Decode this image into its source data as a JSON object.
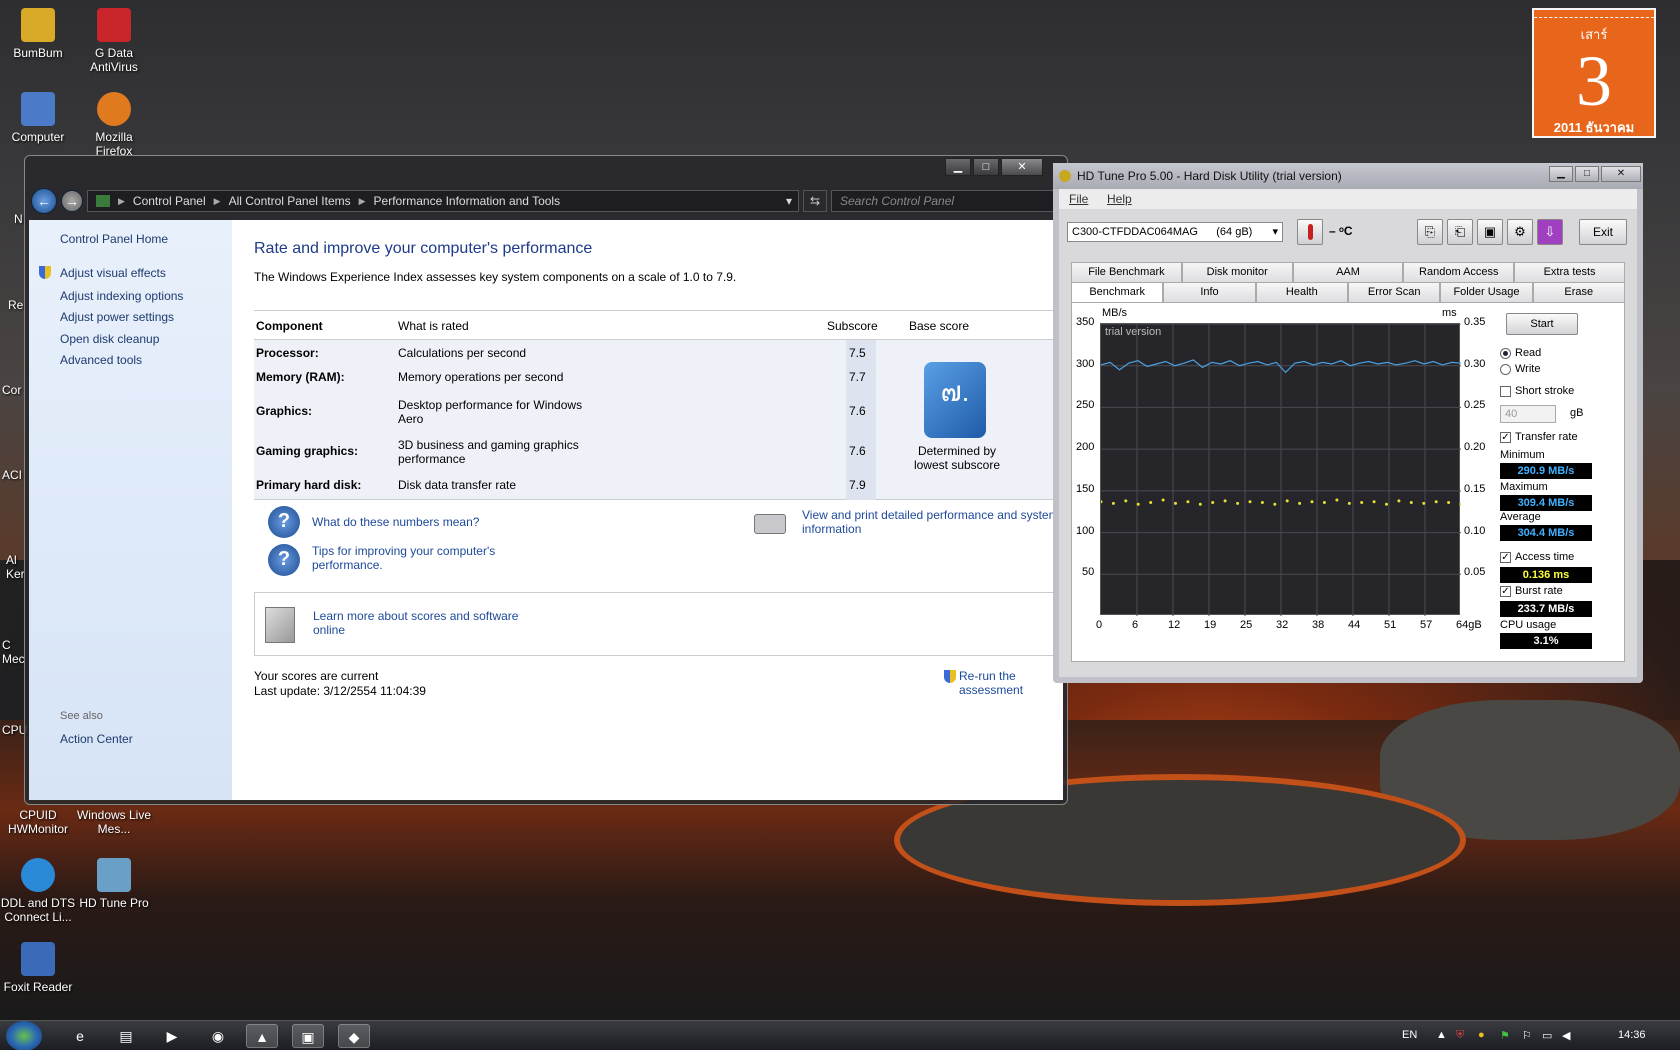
{
  "desktop": {
    "icons": [
      {
        "label": "BumBum",
        "color": "#d9a928"
      },
      {
        "label": "G Data AntiVirus",
        "color": "#c8262a"
      },
      {
        "label": "Computer",
        "color": "#4a7ac8"
      },
      {
        "label": "Mozilla Firefox",
        "color": "#e07a1e"
      },
      {
        "label": "CPUID HWMonitor",
        "color": "#888888"
      },
      {
        "label": "Windows Live Mes...",
        "color": "#4a9ad8"
      },
      {
        "label": "DDL and DTS Connect Li...",
        "color": "#2a8ad8"
      },
      {
        "label": "HD Tune Pro",
        "color": "#6aa0c8"
      },
      {
        "label": "Foxit Reader",
        "color": "#3a6ab8"
      }
    ],
    "edge_labels": [
      "N",
      "Re",
      "Cor",
      "ACI",
      "Al Ker",
      "C Mec",
      "CPU"
    ]
  },
  "calendar": {
    "dow": "เสาร์",
    "day": "3",
    "month_year": "2011 ธันวาคม"
  },
  "control_panel": {
    "breadcrumb": [
      "Control Panel",
      "All Control Panel Items",
      "Performance Information and Tools"
    ],
    "search_placeholder": "Search Control Panel",
    "sidebar": {
      "home": "Control Panel Home",
      "links": [
        "Adjust visual effects",
        "Adjust indexing options",
        "Adjust power settings",
        "Open disk cleanup",
        "Advanced tools"
      ],
      "see_also": "See also",
      "action_center": "Action Center"
    },
    "title": "Rate and improve your computer's performance",
    "description": "The Windows Experience Index assesses key system components on a scale of 1.0 to 7.9.",
    "headers": {
      "component": "Component",
      "rated": "What is rated",
      "subscore": "Subscore",
      "base": "Base score"
    },
    "rows": [
      {
        "component": "Processor:",
        "rated": "Calculations per second",
        "subscore": "7.5"
      },
      {
        "component": "Memory (RAM):",
        "rated": "Memory operations per second",
        "subscore": "7.7"
      },
      {
        "component": "Graphics:",
        "rated": "Desktop performance for Windows Aero",
        "subscore": "7.6"
      },
      {
        "component": "Gaming graphics:",
        "rated": "3D business and gaming graphics performance",
        "subscore": "7.6"
      },
      {
        "component": "Primary hard disk:",
        "rated": "Disk data transfer rate",
        "subscore": "7.9"
      }
    ],
    "base_score": "๗.",
    "base_caption": "Determined by lowest subscore",
    "links": {
      "what_numbers": "What do these numbers mean?",
      "tips": "Tips for improving your computer's performance.",
      "print": "View and print detailed performance and system information",
      "learn_more": "Learn more about scores and software online",
      "rerun": "Re-run the assessment"
    },
    "status": "Your scores are current",
    "last_update": "Last update: 3/12/2554 11:04:39"
  },
  "hdtune": {
    "title": "HD Tune Pro 5.00 - Hard Disk Utility (trial version)",
    "menu": [
      "File",
      "Help"
    ],
    "drive": "C300-CTFDDAC064MAG      (64 gB)",
    "temp": "– ᵒC",
    "exit": "Exit",
    "tabs_top": [
      "File Benchmark",
      "Disk monitor",
      "AAM",
      "Random Access",
      "Extra tests"
    ],
    "tabs_bottom": [
      "Benchmark",
      "Info",
      "Health",
      "Error Scan",
      "Folder Usage",
      "Erase"
    ],
    "start": "Start",
    "read": "Read",
    "write": "Write",
    "short_stroke": "Short stroke",
    "stroke_value": "40",
    "stroke_unit": "gB",
    "transfer_rate": "Transfer rate",
    "min_label": "Minimum",
    "min_value": "290.9 MB/s",
    "max_label": "Maximum",
    "max_value": "309.4 MB/s",
    "avg_label": "Average",
    "avg_value": "304.4 MB/s",
    "access_label": "Access time",
    "access_value": "0.136 ms",
    "burst_label": "Burst rate",
    "burst_value": "233.7 MB/s",
    "cpu_label": "CPU usage",
    "cpu_value": "3.1%",
    "trial": "trial version",
    "colors": {
      "transfer": "#4aa0e0",
      "access": "#e8e030",
      "min": "#40b0ff",
      "access_val": "#ffff40"
    }
  },
  "chart_data": {
    "type": "line",
    "ylabel_left": "MB/s",
    "ylabel_right": "ms",
    "y_left_ticks": [
      350,
      300,
      250,
      200,
      150,
      100,
      50
    ],
    "y_right_ticks": [
      "0.35",
      "0.30",
      "0.25",
      "0.20",
      "0.15",
      "0.10",
      "0.05"
    ],
    "x_ticks": [
      "0",
      "6",
      "12",
      "19",
      "25",
      "32",
      "38",
      "44",
      "51",
      "57",
      "64gB"
    ],
    "ylim_left": [
      0,
      350
    ],
    "ylim_right": [
      0,
      0.35
    ],
    "series": [
      {
        "values": [
          301,
          304,
          295,
          303,
          306,
          299,
          302,
          305,
          300,
          303,
          307,
          298,
          304,
          302,
          306,
          300,
          303,
          305,
          301,
          304,
          292,
          303,
          305,
          301,
          304,
          302,
          306,
          300,
          303,
          305,
          302,
          304,
          301,
          303,
          306,
          302,
          305,
          301,
          304,
          303
        ]
      },
      {
        "values": [
          0.137,
          0.135,
          0.138,
          0.134,
          0.136,
          0.139,
          0.135,
          0.137,
          0.134,
          0.136,
          0.138,
          0.135,
          0.137,
          0.136,
          0.134,
          0.138,
          0.135,
          0.137,
          0.136,
          0.139,
          0.135,
          0.136,
          0.137,
          0.134,
          0.138,
          0.136,
          0.135,
          0.137,
          0.136,
          0.134
        ]
      }
    ]
  },
  "taskbar": {
    "lang": "EN",
    "clock": "14:36"
  }
}
